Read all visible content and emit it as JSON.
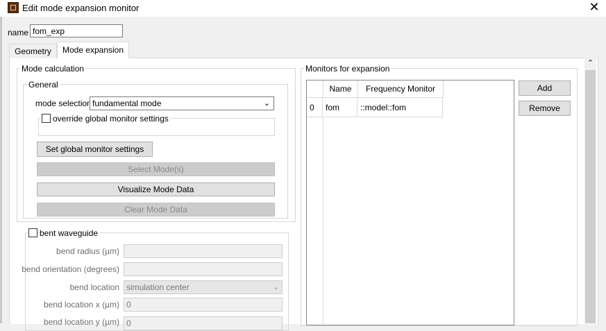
{
  "window": {
    "title": "Edit mode expansion monitor",
    "close_glyph": "✕",
    "app_icon": "lumerical-app-icon"
  },
  "name_field": {
    "label": "name",
    "value": "fom_exp"
  },
  "tabs": [
    {
      "label": "Geometry",
      "active": false
    },
    {
      "label": "Mode expansion",
      "active": true
    }
  ],
  "mode_calculation": {
    "title": "Mode calculation",
    "general": {
      "title": "General",
      "mode_selection_label": "mode selection",
      "mode_selection_value": "fundamental mode",
      "override_label": "override global monitor settings",
      "override_checked": false,
      "set_global_button": "Set global monitor settings",
      "select_modes_button": "Select Mode(s)",
      "visualize_button": "Visualize Mode Data",
      "clear_button": "Clear Mode Data"
    },
    "bent": {
      "label": "bent waveguide",
      "checked": false,
      "bend_radius_label": "bend radius (µm)",
      "bend_radius_value": "",
      "bend_orientation_label": "bend orientation (degrees)",
      "bend_orientation_value": "",
      "bend_location_label": "bend location",
      "bend_location_value": "simulation center",
      "bend_location_x_label": "bend location x (µm)",
      "bend_location_x_value": "0",
      "bend_location_y_label": "bend location y (µm)",
      "bend_location_y_value": "0"
    }
  },
  "monitors": {
    "title": "Monitors for expansion",
    "columns": [
      "Name",
      "Frequency Monitor"
    ],
    "rows": [
      {
        "index": "0",
        "name": "fom",
        "frequency_monitor": "::model::fom"
      }
    ],
    "add_button": "Add",
    "remove_button": "Remove"
  },
  "scrollbar": {
    "up_glyph": "⌃"
  }
}
